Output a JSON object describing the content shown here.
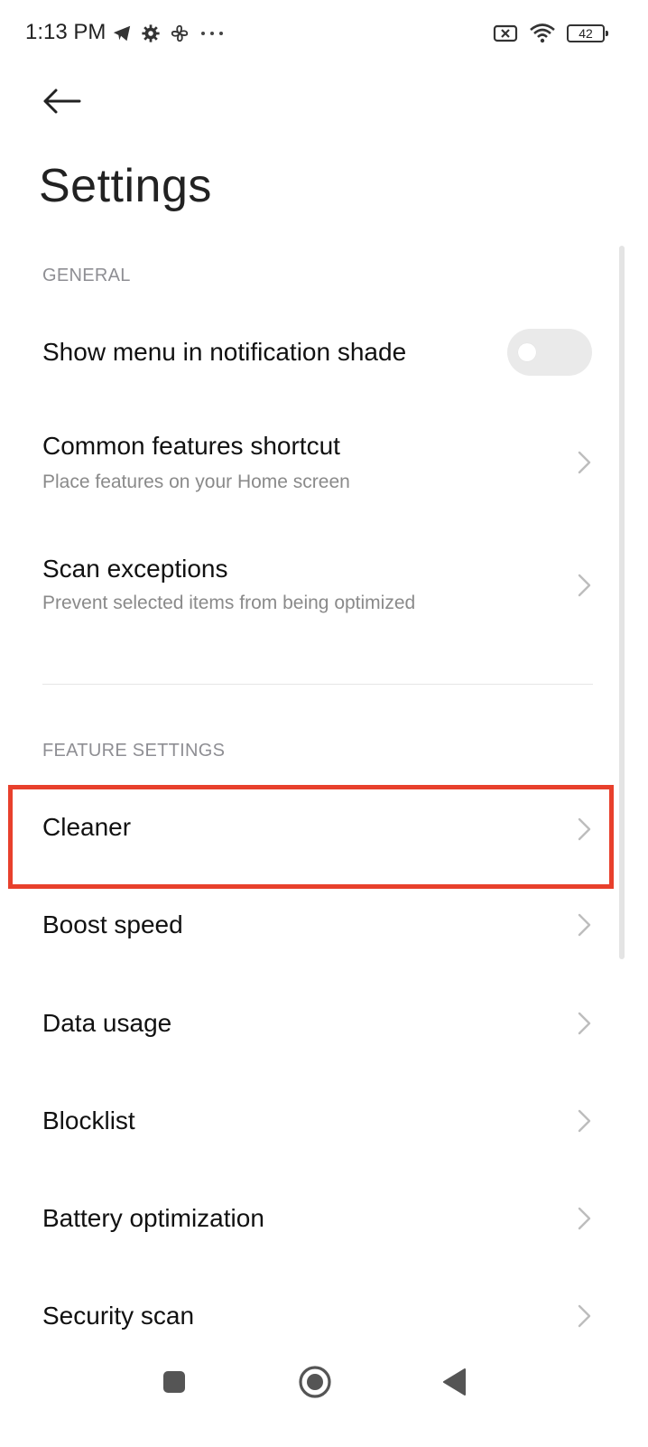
{
  "status_bar": {
    "time": "1:13 PM",
    "battery_level": "42",
    "left_icons": [
      "telegram-icon",
      "gear-icon",
      "fan-icon",
      "more-dots-icon"
    ],
    "right_icons": [
      "no-sim-icon",
      "wifi-icon",
      "battery-icon"
    ]
  },
  "header": {
    "title": "Settings"
  },
  "sections": {
    "general": {
      "label": "GENERAL",
      "items": [
        {
          "title": "Show menu in notification shade",
          "toggle_on": false
        },
        {
          "title": "Common features shortcut",
          "subtitle": "Place features on your Home screen"
        },
        {
          "title": "Scan exceptions",
          "subtitle": "Prevent selected items from being optimized"
        }
      ]
    },
    "feature_settings": {
      "label": "FEATURE SETTINGS",
      "items": [
        {
          "title": "Cleaner"
        },
        {
          "title": "Boost speed"
        },
        {
          "title": "Data usage"
        },
        {
          "title": "Blocklist"
        },
        {
          "title": "Battery optimization"
        },
        {
          "title": "Security scan"
        }
      ]
    }
  },
  "colors": {
    "highlight": "#e8402c",
    "section_label": "#8e8e93",
    "toggle_off": "#eaeaea"
  },
  "nav_bar": {
    "buttons": [
      "recents-square-icon",
      "home-circle-icon",
      "back-triangle-icon"
    ]
  }
}
